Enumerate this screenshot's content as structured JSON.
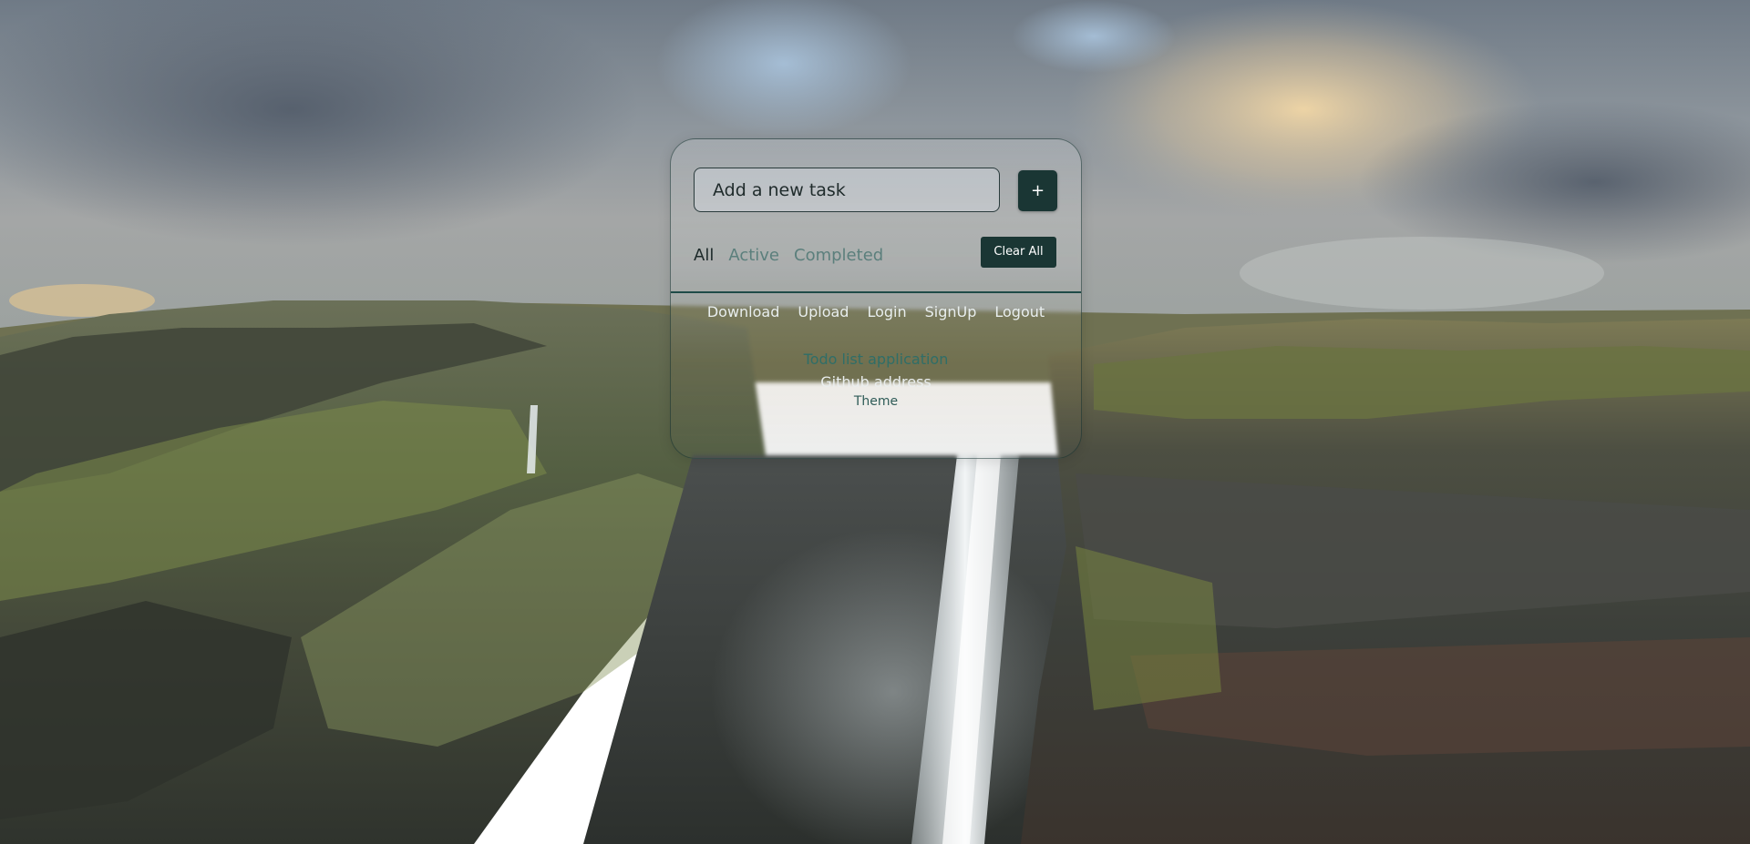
{
  "colors": {
    "accent": "#1a3634",
    "divider": "#1f4b47",
    "title_text": "#2f6e68",
    "inactive_filter": "#5b7f7c"
  },
  "todo": {
    "input": {
      "placeholder": "Add a new task",
      "value": ""
    },
    "add_button_label": "+",
    "filters": [
      {
        "label": "All",
        "active": true
      },
      {
        "label": "Active",
        "active": false
      },
      {
        "label": "Completed",
        "active": false
      }
    ],
    "clear_all_label": "Clear All"
  },
  "nav": {
    "links": [
      {
        "label": "Download"
      },
      {
        "label": "Upload"
      },
      {
        "label": "Login"
      },
      {
        "label": "SignUp"
      },
      {
        "label": "Logout"
      }
    ]
  },
  "footer": {
    "title": "Todo list application",
    "github": "Github address",
    "theme": "Theme"
  },
  "background": {
    "description_icon": "waterfall-landscape-image"
  }
}
